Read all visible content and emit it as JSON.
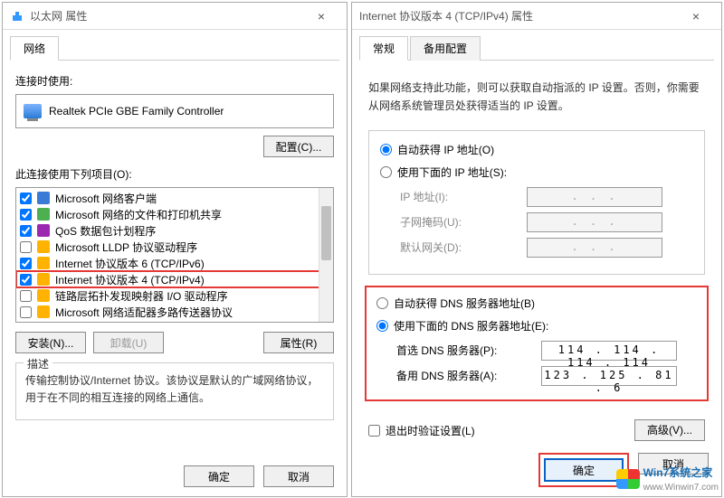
{
  "left": {
    "title": "以太网 属性",
    "tabs": [
      "网络"
    ],
    "connect_using_label": "连接时使用:",
    "adapter": "Realtek PCIe GBE Family Controller",
    "configure_btn": "配置(C)...",
    "items_label": "此连接使用下列项目(O):",
    "items": [
      {
        "checked": true,
        "icon": "pi-net",
        "label": "Microsoft 网络客户端"
      },
      {
        "checked": true,
        "icon": "pi-file",
        "label": "Microsoft 网络的文件和打印机共享"
      },
      {
        "checked": true,
        "icon": "pi-qos",
        "label": "QoS 数据包计划程序"
      },
      {
        "checked": false,
        "icon": "pi-drv",
        "label": "Microsoft LLDP 协议驱动程序"
      },
      {
        "checked": true,
        "icon": "pi-drv",
        "label": "Internet 协议版本 6 (TCP/IPv6)"
      },
      {
        "checked": true,
        "icon": "pi-drv",
        "label": "Internet 协议版本 4 (TCP/IPv4)",
        "highlight": true
      },
      {
        "checked": false,
        "icon": "pi-drv",
        "label": "链路层拓扑发现映射器 I/O 驱动程序"
      },
      {
        "checked": false,
        "icon": "pi-drv",
        "label": "Microsoft 网络适配器多路传送器协议"
      }
    ],
    "install_btn": "安装(N)...",
    "uninstall_btn": "卸载(U)",
    "properties_btn": "属性(R)",
    "desc_legend": "描述",
    "desc_text": "传输控制协议/Internet 协议。该协议是默认的广域网络协议，用于在不同的相互连接的网络上通信。",
    "ok": "确定",
    "cancel": "取消"
  },
  "right": {
    "title": "Internet 协议版本 4 (TCP/IPv4) 属性",
    "tabs": [
      "常规",
      "备用配置"
    ],
    "intro": "如果网络支持此功能，则可以获取自动指派的 IP 设置。否则，你需要从网络系统管理员处获得适当的 IP 设置。",
    "ip": {
      "auto_label": "自动获得 IP 地址(O)",
      "manual_label": "使用下面的 IP 地址(S):",
      "auto_selected": true,
      "fields": {
        "ip_label": "IP 地址(I):",
        "mask_label": "子网掩码(U):",
        "gw_label": "默认网关(D):",
        "ip_value": ".   .   .",
        "mask_value": ".   .   .",
        "gw_value": ".   .   ."
      }
    },
    "dns": {
      "auto_label": "自动获得 DNS 服务器地址(B)",
      "manual_label": "使用下面的 DNS 服务器地址(E):",
      "manual_selected": true,
      "fields": {
        "pref_label": "首选 DNS 服务器(P):",
        "alt_label": "备用 DNS 服务器(A):",
        "pref_value": "114 . 114 . 114 . 114",
        "alt_value": "123 . 125 .  81 .   6"
      }
    },
    "validate_label": "退出时验证设置(L)",
    "advanced_btn": "高级(V)...",
    "ok": "确定",
    "cancel": "取消"
  },
  "watermark": {
    "brand": "Win7系统之家",
    "url": "www.Winwin7.com"
  }
}
